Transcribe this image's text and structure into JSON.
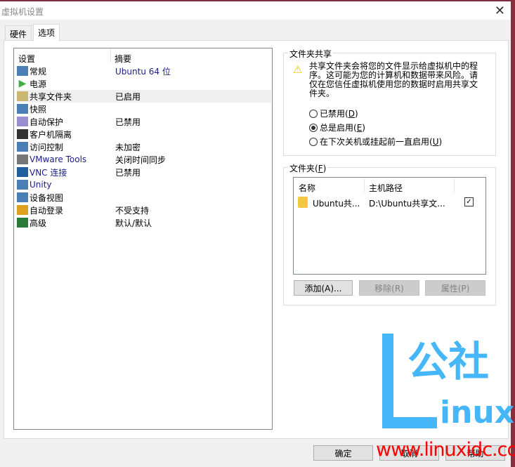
{
  "window": {
    "title": "虚拟机设置",
    "close": "✕"
  },
  "tabs": [
    {
      "label": "硬件"
    },
    {
      "label": "选项"
    }
  ],
  "settings": {
    "col_setting": "设置",
    "col_summary": "摘要",
    "items": [
      {
        "label": "常规",
        "summary": "Ubuntu 64 位",
        "icon": "monitor-icon"
      },
      {
        "label": "电源",
        "summary": "",
        "icon": "power-play-icon"
      },
      {
        "label": "共享文件夹",
        "summary": "已启用",
        "icon": "shared-folder-icon"
      },
      {
        "label": "快照",
        "summary": "",
        "icon": "snapshot-icon"
      },
      {
        "label": "自动保护",
        "summary": "已禁用",
        "icon": "autoprotect-icon"
      },
      {
        "label": "客户机隔离",
        "summary": "",
        "icon": "lock-icon"
      },
      {
        "label": "访问控制",
        "summary": "未加密",
        "icon": "access-control-icon"
      },
      {
        "label": "VMware Tools",
        "summary": "关闭时间同步",
        "icon": "vmware-tools-icon"
      },
      {
        "label": "VNC 连接",
        "summary": "已禁用",
        "icon": "vnc-icon"
      },
      {
        "label": "Unity",
        "summary": "",
        "icon": "unity-icon"
      },
      {
        "label": "设备视图",
        "summary": "",
        "icon": "device-view-icon"
      },
      {
        "label": "自动登录",
        "summary": "不受支持",
        "icon": "autologin-icon"
      },
      {
        "label": "高级",
        "summary": "默认/默认",
        "icon": "advanced-icon"
      }
    ]
  },
  "sharing": {
    "title": "文件夹共享",
    "warning": "共享文件夹会将您的文件显示给虚拟机中的程序。这可能为您的计算机和数据带来风险。请仅在您信任虚拟机使用您的数据时启用共享文件夹。",
    "options": [
      {
        "label": "已禁用",
        "key": "D",
        "checked": false
      },
      {
        "label": "总是启用",
        "key": "E",
        "checked": true
      },
      {
        "label": "在下次关机或挂起前一直启用",
        "key": "U",
        "checked": false
      }
    ]
  },
  "folders": {
    "title": "文件夹",
    "key": "F",
    "col_name": "名称",
    "col_path": "主机路径",
    "rows": [
      {
        "name": "Ubuntu共...",
        "path": "D:\\Ubuntu共享文...",
        "enabled": true
      }
    ],
    "add": "添加(A)...",
    "remove": "移除(R)",
    "properties": "属性(P)"
  },
  "footer": {
    "ok": "确定",
    "cancel": "取消",
    "help": "帮助"
  },
  "watermark": {
    "logo": "L公社 inux",
    "url": "www.linuxidc.com"
  }
}
